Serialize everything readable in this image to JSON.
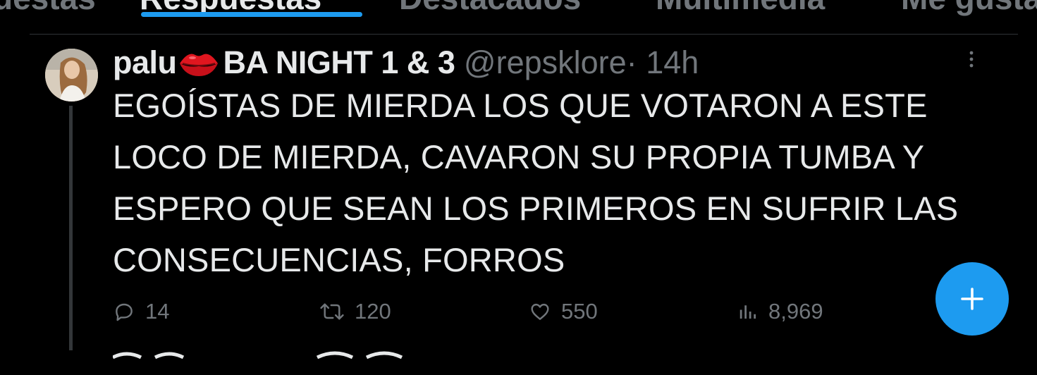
{
  "tabs": [
    {
      "label": "uestas",
      "active": false
    },
    {
      "label": "Respuestas",
      "active": true
    },
    {
      "label": "Destacados",
      "active": false
    },
    {
      "label": "Multimedia",
      "active": false
    },
    {
      "label": "Me gusta",
      "active": false
    }
  ],
  "tweet": {
    "display_name": "palu",
    "name_suffix": "BA NIGHT 1 & 3",
    "handle": "@repsklore",
    "separator": "·",
    "time": "14h",
    "text": "EGOÍSTAS DE MIERDA LOS QUE VOTARON A ESTE LOCO DE MIERDA, CAVARON SU PROPIA TUMBA Y ESPERO QUE SEAN LOS PRIMEROS EN SUFRIR LAS CONSECUENCIAS, FORROS",
    "actions": {
      "replies": "14",
      "retweets": "120",
      "likes": "550",
      "views": "8,969"
    }
  },
  "colors": {
    "background": "#000000",
    "text": "#e7e9ea",
    "muted": "#71767b",
    "accent": "#1d9bf0",
    "divider": "#2f3336"
  },
  "icons": [
    "lips-emoji",
    "more-icon",
    "reply-icon",
    "retweet-icon",
    "like-icon",
    "views-icon",
    "plus-icon"
  ]
}
